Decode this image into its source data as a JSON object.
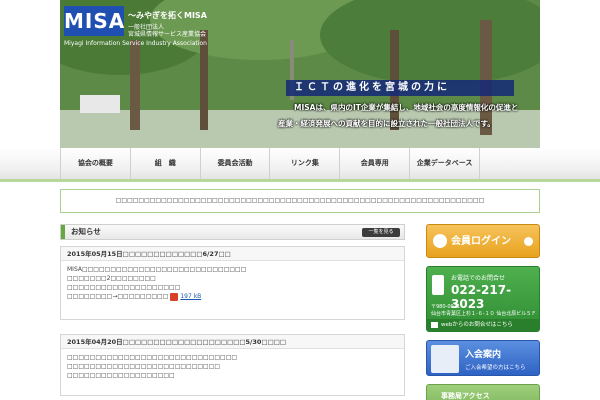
{
  "header": {
    "logo_text": "MISA",
    "tagline": "～みやぎを拓くMISA",
    "org_type": "一般社団法人",
    "org_name_jp": "宮城県情報サービス産業協会",
    "org_name_en": "Miyagi Information Service Industry Association",
    "catchphrase": "ＩＣＴの進化を宮城の力に",
    "description_line1": "MISAは、県内のIT企業が集結し、地域社会の高度情報化の促進と",
    "description_line2": "産業・経済発展への貢献を目的に設立された一般社団法人です。"
  },
  "nav": {
    "items": [
      "協会の概要",
      "組　織",
      "委員会活動",
      "リンク集",
      "会員専用",
      "企業データベース"
    ]
  },
  "notice": {
    "text": "□□□□□□□□□□□□□□□□□□□□□□□□□□□□□□□□□□□□□□□□□□□□□□□□□□□□□□□□□□□□□□□□□"
  },
  "news": {
    "title": "お知らせ",
    "more_label": "一覧を見る",
    "items": [
      {
        "title": "2015年05月15日□□□□□□□□□□□□□6/27□□",
        "lines": [
          "MISA□□□□□□□□□□□□□□□□□□□□□□□□□□□□□",
          "□□□□□□□2□□□□□□□□",
          "□□□□□□□□□□□□□□□□□□□□",
          "□□□□□□□□→□□□□□□□□□"
        ],
        "file_size": "197 kB"
      },
      {
        "title": "2015年04月20日□□□□□□□□□□□□□□□□□□□□5/30□□□□",
        "lines": [
          "□□□□□□□□□□□□□□□□□□□□□□□□□□□□□□",
          "□□□□□□□□□□□□□□□□□□□□□□□□□□□",
          "□□□□□□□□□□□□□□□□□□□"
        ]
      }
    ]
  },
  "sidebar": {
    "login_label": "会員ログイン",
    "contact": {
      "tel_label": "お電話でのお問合せ",
      "tel": "022-217-3023",
      "zip": "〒980-0011",
      "address": "仙台市青葉区上杉１-６-１０ 仙台北辰ビル５Ｆ",
      "web_label": "webからのお問合せはこちら"
    },
    "join": {
      "title": "入会案内",
      "subtitle": "ご入会希望の方はこちら"
    },
    "office": {
      "title": "事務局アクセス"
    }
  },
  "colors": {
    "accent_green": "#67a83e",
    "login_orange": "#e8a21f",
    "contact_green": "#2f8d32",
    "join_blue": "#2f63c4",
    "logo_blue": "#1f4fb0"
  }
}
